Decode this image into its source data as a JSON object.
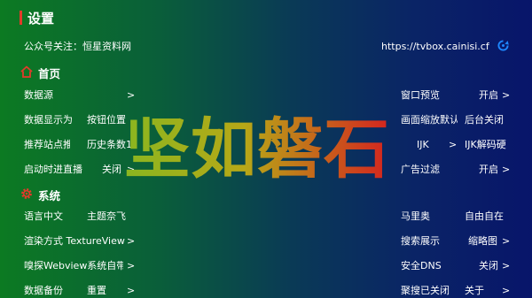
{
  "header": {
    "title": "设置"
  },
  "notice": {
    "label": "公众号关注：恒星资料网",
    "url": "https://tvbox.cainisi.cf"
  },
  "sections": {
    "home": "首页",
    "system": "系统"
  },
  "left_rows": [
    {
      "label": "数据源",
      "value": "",
      "arrow": ">"
    },
    {
      "label": "数据显示为",
      "value": "按钮位置",
      "arrow": ""
    },
    {
      "label": "推荐站点推",
      "value": "历史条数10",
      "arrow": ""
    },
    {
      "label": "启动时进直播",
      "value": "关闭",
      "arrow": ">"
    },
    {
      "label": "语言中文",
      "value": "主题奈飞",
      "arrow": ""
    },
    {
      "label": "渲染方式 TextureView",
      "value": "",
      "arrow": ">"
    },
    {
      "label": "嗅探Webview系统自带",
      "value": "",
      "arrow": ">"
    },
    {
      "label": "数据备份",
      "value": "重置",
      "arrow": ">"
    }
  ],
  "right_rows": [
    {
      "label": "窗口预览",
      "value": "开启",
      "arrow": ">"
    },
    {
      "label": "画面缩放默认",
      "value": "后台关闭",
      "arrow": ""
    },
    {
      "label": "IJK",
      "value": "IJK解码硬",
      "arrow": ">"
    },
    {
      "label": "广告过滤",
      "value": "开启",
      "arrow": ">"
    },
    {
      "label": "马里奥",
      "value": "自由自在",
      "arrow": ">"
    },
    {
      "label": "搜索展示",
      "value": "缩略图",
      "arrow": ">"
    },
    {
      "label": "安全DNS",
      "value": "关闭",
      "arrow": ">"
    },
    {
      "label": "聚搜已关闭",
      "value": "关于",
      "arrow": ">"
    }
  ],
  "watermark": "坚如磐石",
  "colors": {
    "accent_bar": "#e23b2a",
    "icon_red": "#e23b2a",
    "refresh_blue": "#1e88ff"
  },
  "icons": {
    "home": "home-icon",
    "system": "gear-icon",
    "refresh": "refresh-icon"
  }
}
